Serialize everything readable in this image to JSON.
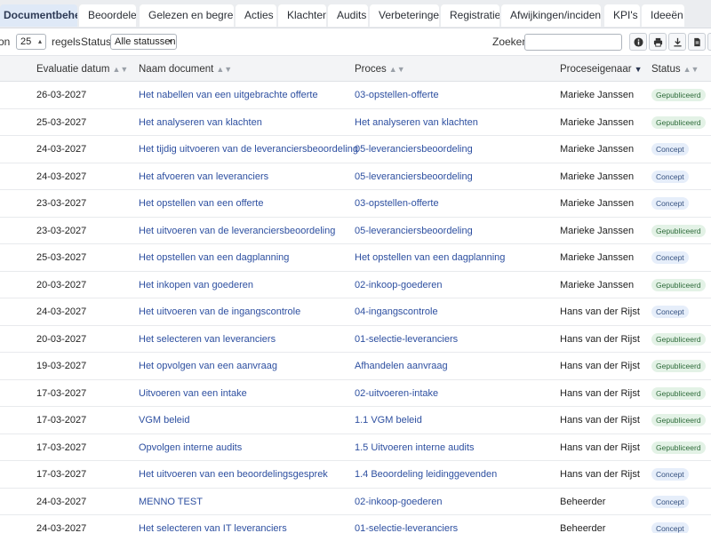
{
  "tabs": [
    {
      "label": "Documentbeheer",
      "active": true
    },
    {
      "label": "Beoordelen"
    },
    {
      "label": "Gelezen en begrepen"
    },
    {
      "label": "Acties"
    },
    {
      "label": "Klachten"
    },
    {
      "label": "Audits"
    },
    {
      "label": "Verbeteringen"
    },
    {
      "label": "Registraties"
    },
    {
      "label": "Afwijkingen/incidenten"
    },
    {
      "label": "KPI's"
    },
    {
      "label": "Ideeën"
    }
  ],
  "toolbar": {
    "length_prefix": "on",
    "length_value": "25",
    "length_suffix": "regels",
    "status_label": "Status:",
    "status_value": "Alle statussen",
    "search_label": "Zoeken:",
    "search_value": "",
    "icons": [
      "info-icon",
      "print-icon",
      "download-icon",
      "file-icon",
      "more-icon"
    ]
  },
  "table": {
    "headers": {
      "date": "Evaluatie datum",
      "doc": "Naam document",
      "proc": "Proces",
      "owner": "Proceseigenaar",
      "status": "Status"
    },
    "rows": [
      {
        "date": "26-03-2027",
        "doc": "Het nabellen van een uitgebrachte offerte",
        "proc": "03-opstellen-offerte",
        "owner": "Marieke Janssen",
        "status": "Gepubliceerd"
      },
      {
        "date": "25-03-2027",
        "doc": "Het analyseren van klachten",
        "proc": "Het analyseren van klachten",
        "owner": "Marieke Janssen",
        "status": "Gepubliceerd"
      },
      {
        "date": "24-03-2027",
        "doc": "Het tijdig uitvoeren van de leveranciersbeoordeling",
        "proc": "05-leveranciersbeoordeling",
        "owner": "Marieke Janssen",
        "status": "Concept"
      },
      {
        "date": "24-03-2027",
        "doc": "Het afvoeren van leveranciers",
        "proc": "05-leveranciersbeoordeling",
        "owner": "Marieke Janssen",
        "status": "Concept"
      },
      {
        "date": "23-03-2027",
        "doc": "Het opstellen van een offerte",
        "proc": "03-opstellen-offerte",
        "owner": "Marieke Janssen",
        "status": "Concept"
      },
      {
        "date": "23-03-2027",
        "doc": "Het uitvoeren van de leveranciersbeoordeling",
        "proc": "05-leveranciersbeoordeling",
        "owner": "Marieke Janssen",
        "status": "Gepubliceerd"
      },
      {
        "date": "25-03-2027",
        "doc": "Het opstellen van een dagplanning",
        "proc": "Het opstellen van een dagplanning",
        "owner": "Marieke Janssen",
        "status": "Concept"
      },
      {
        "date": "20-03-2027",
        "doc": "Het inkopen van goederen",
        "proc": "02-inkoop-goederen",
        "owner": "Marieke Janssen",
        "status": "Gepubliceerd"
      },
      {
        "date": "24-03-2027",
        "doc": "Het uitvoeren van de ingangscontrole",
        "proc": "04-ingangscontrole",
        "owner": "Hans van der Rijst",
        "status": "Concept"
      },
      {
        "date": "20-03-2027",
        "doc": "Het selecteren van leveranciers",
        "proc": "01-selectie-leveranciers",
        "owner": "Hans van der Rijst",
        "status": "Gepubliceerd"
      },
      {
        "date": "19-03-2027",
        "doc": "Het opvolgen van een aanvraag",
        "proc": "Afhandelen aanvraag",
        "owner": "Hans van der Rijst",
        "status": "Gepubliceerd"
      },
      {
        "date": "17-03-2027",
        "doc": "Uitvoeren van een intake",
        "proc": "02-uitvoeren-intake",
        "owner": "Hans van der Rijst",
        "status": "Gepubliceerd"
      },
      {
        "date": "17-03-2027",
        "doc": "VGM beleid",
        "proc": "1.1 VGM beleid",
        "owner": "Hans van der Rijst",
        "status": "Gepubliceerd"
      },
      {
        "date": "17-03-2027",
        "doc": "Opvolgen interne audits",
        "proc": "1.5 Uitvoeren interne audits",
        "owner": "Hans van der Rijst",
        "status": "Gepubliceerd"
      },
      {
        "date": "17-03-2027",
        "doc": "Het uitvoeren van een beoordelingsgesprek",
        "proc": "1.4 Beoordeling leidinggevenden",
        "owner": "Hans van der Rijst",
        "status": "Concept"
      },
      {
        "date": "24-03-2027",
        "doc": "MENNO TEST",
        "proc": "02-inkoop-goederen",
        "owner": "Beheerder",
        "status": "Concept"
      },
      {
        "date": "24-03-2027",
        "doc": "Het selecteren van IT leveranciers",
        "proc": "01-selectie-leveranciers",
        "owner": "Beheerder",
        "status": "Concept"
      }
    ]
  },
  "colors": {
    "link": "#2d4fa0",
    "published_bg": "#e3f2e6",
    "concept_bg": "#e6eefa",
    "active_tab_bg": "#dfe9f7"
  }
}
